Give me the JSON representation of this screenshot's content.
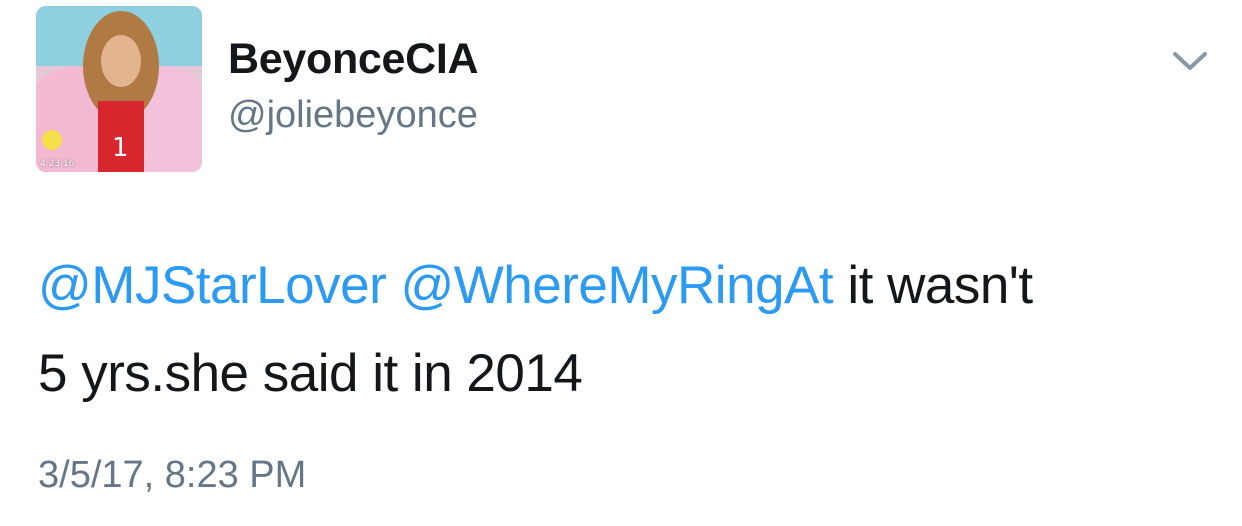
{
  "tweet": {
    "author": {
      "display_name": "BeyonceCIA",
      "handle": "@joliebeyonce",
      "avatar_caption": "4.23.16"
    },
    "mentions": [
      {
        "text": "@MJStarLover"
      },
      {
        "text": "@WhereMyRingAt"
      }
    ],
    "text_line1_rest": "it wasn't",
    "text_line2": "5 yrs.she said it in 2014",
    "timestamp": "3/5/17, 8:23 PM"
  },
  "icons": {
    "menu": "chevron-down-icon"
  },
  "colors": {
    "mention": "#2b9af3",
    "text": "#14171a",
    "secondary": "#657786"
  }
}
